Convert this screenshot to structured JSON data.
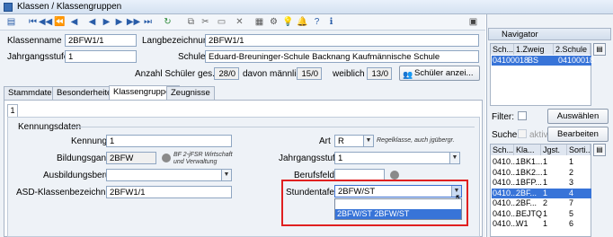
{
  "window": {
    "title": "Klassen / Klassengruppen"
  },
  "toolbar": {
    "icons": [
      "new-icon",
      "first-icon",
      "prev-page-icon",
      "prev-icon",
      "next-icon",
      "next-page-icon",
      "last-icon",
      "refresh-icon",
      "copy-icon",
      "cut-icon",
      "paste-icon",
      "delete-icon",
      "grid-icon",
      "settings-icon",
      "bulb-icon",
      "bell-icon",
      "help-icon",
      "filter-icon",
      "lock-icon"
    ]
  },
  "header": {
    "klassenname_label": "Klassenname",
    "klassenname_value": "2BFW1/1",
    "langbezeichnung_label": "Langbezeichnung",
    "langbezeichnung_value": "2BFW1/1",
    "jahrgangsstufe_label": "Jahrgangsstufe",
    "jahrgangsstufe_value": "1",
    "schule_label": "Schule",
    "schule_value": "Eduard-Breuninger-Schule Backnang Kaufmännische Schule",
    "anzahl_label": "Anzahl Schüler ges.",
    "anzahl_value": "28/0",
    "maennlich_label": "davon männlich",
    "maennlich_value": "15/0",
    "weiblich_label": "weiblich",
    "weiblich_value": "13/0",
    "schueler_button": "Schüler anzei..."
  },
  "tabs": [
    "Stammdaten",
    "Besonderheiten",
    "Klassengruppen",
    "Zeugnisse"
  ],
  "subtab": "1",
  "kennung": {
    "section_title": "Kennungsdaten",
    "kennung_label": "Kennung",
    "kennung_value": "1",
    "bildungsgang_label": "Bildungsgang",
    "bildungsgang_value": "2BFW",
    "bildungsgang_note": "BF 2-jFSR Wirtschaft und Verwaltung",
    "ausbildungsberuf_label": "Ausbildungsberuf",
    "ausbildungsberuf_value": "",
    "asd_label": "ASD-Klassenbezeichnung",
    "asd_value": "2BFW1/1",
    "art_label": "Art",
    "art_value": "R",
    "art_note": "Regelklasse, auch jgübergr.",
    "jahrgangsstufe_label": "Jahrgangsstufe",
    "jahrgangsstufe_value": "1",
    "berufsfeld_label": "Berufsfeld",
    "berufsfeld_value": "",
    "stundentafel_label": "Stundentafel",
    "stundentafel_value": "2BFW/ST",
    "stundentafel_option": "2BFW/ST 2BFW/ST"
  },
  "navigator": {
    "title": "Navigator",
    "columns_top": [
      "Sch...",
      "1.Zweig",
      "2.Schule"
    ],
    "top_row": [
      "04100018",
      "BS",
      "04100018"
    ],
    "filter_label": "Filter:",
    "auswaehlen_button": "Auswählen",
    "suche_label": "Suche:",
    "aktiv_label": "aktiv",
    "bearbeiten_button": "Bearbeiten",
    "columns": [
      "Sch...",
      "Kla...",
      "Jgst.",
      "Sorti..."
    ],
    "rows": [
      [
        "0410...",
        "1BK1...",
        "1",
        "1"
      ],
      [
        "0410...",
        "1BK2...",
        "1",
        "2"
      ],
      [
        "0410...",
        "1BFP...",
        "1",
        "3"
      ],
      [
        "0410...",
        "2BF...",
        "1",
        "4"
      ],
      [
        "0410...",
        "2BF...",
        "2",
        "7"
      ],
      [
        "0410...",
        "BEJTQ",
        "1",
        "5"
      ],
      [
        "0410...",
        "W1",
        "1",
        "6"
      ]
    ],
    "selected_row": 3
  }
}
